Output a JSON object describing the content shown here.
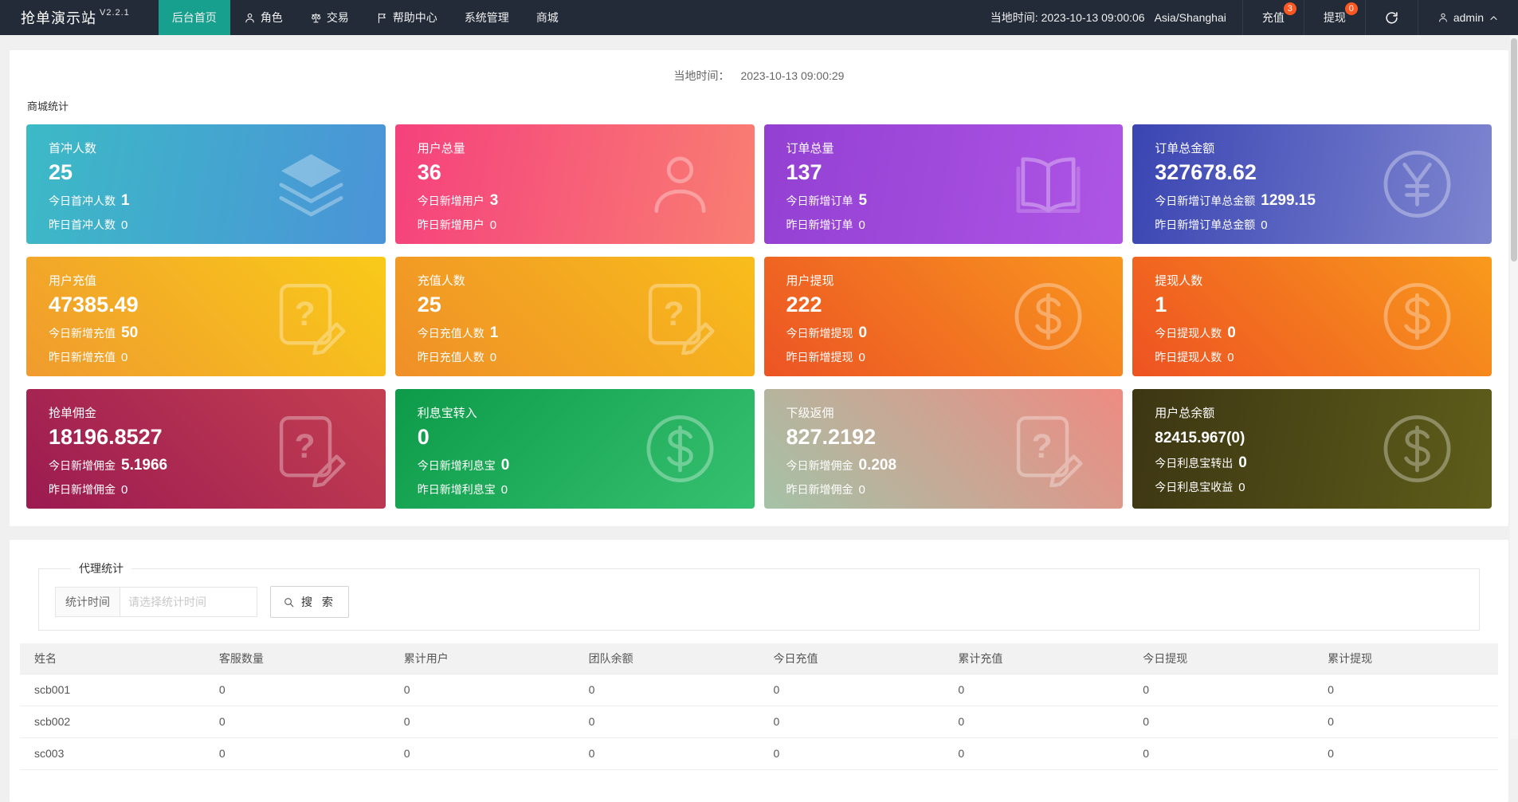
{
  "theme": {
    "navbar_bg": "#222b37",
    "accent_green": "#17a08e",
    "badge_color": "#ff5722",
    "page_bg": "#f0f0f0"
  },
  "navbar": {
    "brand": "抢单演示站",
    "version": "V2.2.1",
    "menu": [
      {
        "key": "home",
        "label": "后台首页",
        "icon": null,
        "active": true
      },
      {
        "key": "role",
        "label": "角色",
        "icon": "person",
        "active": false
      },
      {
        "key": "trade",
        "label": "交易",
        "icon": "scales",
        "active": false
      },
      {
        "key": "help-center",
        "label": "帮助中心",
        "icon": "flag",
        "active": false
      },
      {
        "key": "system-management",
        "label": "系统管理",
        "icon": null,
        "active": false
      },
      {
        "key": "mall",
        "label": "商城",
        "icon": null,
        "active": false
      }
    ],
    "local_time_label": "当地时间:",
    "local_time": "2023-10-13 09:00:06",
    "timezone": "Asia/Shanghai",
    "recharge_label": "充值",
    "recharge_badge": "3",
    "withdraw_label": "提现",
    "withdraw_badge": "0",
    "user": "admin"
  },
  "overview": {
    "time_label": "当地时间：",
    "time_value": "2023-10-13 09:00:29",
    "section_title": "商城统计",
    "cards": [
      {
        "key": "first-recharge-users",
        "title": "首冲人数",
        "value": "25",
        "today_label": "今日首冲人数",
        "today_value": "1",
        "yesterday_label": "昨日首冲人数",
        "yesterday_value": "0",
        "icon": "layers",
        "gradient": "linear-gradient(100deg, #3cbac6 0%, #4b93d8 100%)",
        "small": false
      },
      {
        "key": "total-users",
        "title": "用户总量",
        "value": "36",
        "today_label": "今日新增用户",
        "today_value": "3",
        "yesterday_label": "昨日新增用户",
        "yesterday_value": "0",
        "icon": "person",
        "gradient": "linear-gradient(100deg, #f5417d 0%, #f97e72 100%)",
        "small": false
      },
      {
        "key": "total-orders",
        "title": "订单总量",
        "value": "137",
        "today_label": "今日新增订单",
        "today_value": "5",
        "yesterday_label": "昨日新增订单",
        "yesterday_value": "0",
        "icon": "book",
        "gradient": "linear-gradient(100deg, #9340d2 0%, #ae55e5 100%)",
        "small": false
      },
      {
        "key": "total-order-amount",
        "title": "订单总金额",
        "value": "327678.62",
        "today_label": "今日新增订单总金额",
        "today_value": "1299.15",
        "yesterday_label": "昨日新增订单总金额",
        "yesterday_value": "0",
        "icon": "yen",
        "gradient": "linear-gradient(100deg, #3a45b2 0%, #7e86d0 100%)",
        "small": false
      },
      {
        "key": "user-recharge",
        "title": "用户充值",
        "value": "47385.49",
        "today_label": "今日新增充值",
        "today_value": "50",
        "yesterday_label": "昨日新增充值",
        "yesterday_value": "0",
        "icon": "doc",
        "gradient": "linear-gradient(45deg, #f09b2e 0%, #f9ca19 100%)",
        "small": false
      },
      {
        "key": "recharge-users",
        "title": "充值人数",
        "value": "25",
        "today_label": "今日充值人数",
        "today_value": "1",
        "yesterday_label": "昨日充值人数",
        "yesterday_value": "0",
        "icon": "doc",
        "gradient": "linear-gradient(45deg, #ef8f28 0%, #f8bd1b 100%)",
        "small": false
      },
      {
        "key": "user-withdraw",
        "title": "用户提现",
        "value": "222",
        "today_label": "今日新增提现",
        "today_value": "0",
        "yesterday_label": "昨日新增提现",
        "yesterday_value": "0",
        "icon": "dollar",
        "gradient": "linear-gradient(45deg, #ec5424 0%, #f8961e 100%)",
        "small": false
      },
      {
        "key": "withdraw-users",
        "title": "提现人数",
        "value": "1",
        "today_label": "今日提现人数",
        "today_value": "0",
        "yesterday_label": "昨日提现人数",
        "yesterday_value": "0",
        "icon": "dollar",
        "gradient": "linear-gradient(45deg, #ee5222 0%, #f89a1c 100%)",
        "small": false
      },
      {
        "key": "grab-commission",
        "title": "抢单佣金",
        "value": "18196.8527",
        "today_label": "今日新增佣金",
        "today_value": "5.1966",
        "yesterday_label": "昨日新增佣金",
        "yesterday_value": "0",
        "icon": "doc",
        "gradient": "linear-gradient(45deg, #9b1b51 0%, #c43f51 100%)",
        "small": false
      },
      {
        "key": "interest-transfer-in",
        "title": "利息宝转入",
        "value": "0",
        "today_label": "今日新增利息宝",
        "today_value": "0",
        "yesterday_label": "昨日新增利息宝",
        "yesterday_value": "0",
        "icon": "dollar",
        "gradient": "linear-gradient(135deg, #0d9b49 0%, #36c170 100%)",
        "small": false
      },
      {
        "key": "subordinate-rebate",
        "title": "下级返佣",
        "value": "827.2192",
        "today_label": "今日新增佣金",
        "today_value": "0.208",
        "yesterday_label": "昨日新增佣金",
        "yesterday_value": "0",
        "icon": "doc",
        "gradient": "linear-gradient(45deg, #a4c2a7 0%, #ee8b82 100%)",
        "small": false
      },
      {
        "key": "user-total-balance",
        "title": "用户总余额",
        "value": "82415.967(0)",
        "today_label": "今日利息宝转出",
        "today_value": "0",
        "yesterday_label": "今日利息宝收益",
        "yesterday_value": "0",
        "icon": "dollar",
        "gradient": "linear-gradient(100deg, #3d3613 0%, #5e5d1a 100%)",
        "small": true
      }
    ]
  },
  "agent": {
    "section_title": "代理统计",
    "filter_label": "统计时间",
    "filter_placeholder": "请选择统计时间",
    "search_label": "搜 索",
    "table": {
      "headers": [
        "姓名",
        "客服数量",
        "累计用户",
        "团队余额",
        "今日充值",
        "累计充值",
        "今日提现",
        "累计提现"
      ],
      "rows": [
        [
          "scb001",
          "0",
          "0",
          "0",
          "0",
          "0",
          "0",
          "0"
        ],
        [
          "scb002",
          "0",
          "0",
          "0",
          "0",
          "0",
          "0",
          "0"
        ],
        [
          "sc003",
          "0",
          "0",
          "0",
          "0",
          "0",
          "0",
          "0"
        ]
      ]
    }
  }
}
